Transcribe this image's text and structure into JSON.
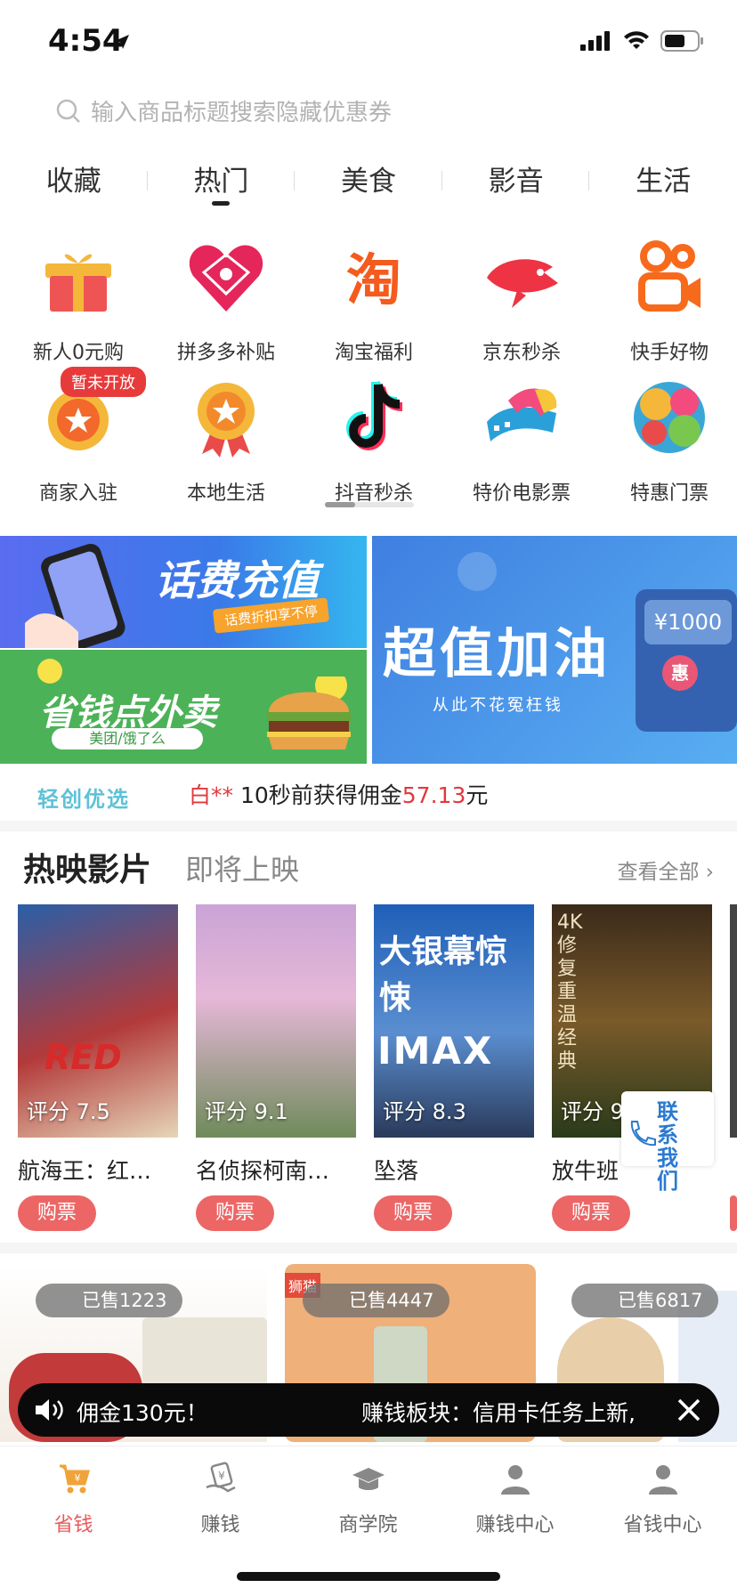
{
  "status": {
    "time": "4:54"
  },
  "search": {
    "placeholder": "输入商品标题搜索隐藏优惠券"
  },
  "tabs": [
    {
      "label": "收藏"
    },
    {
      "label": "热门"
    },
    {
      "label": "美食"
    },
    {
      "label": "影音"
    },
    {
      "label": "生活"
    }
  ],
  "grid": [
    {
      "label": "新人0元购",
      "icon": "gift-icon"
    },
    {
      "label": "拼多多补贴",
      "icon": "pinduoduo-icon"
    },
    {
      "label": "淘宝福利",
      "icon": "taobao-icon"
    },
    {
      "label": "京东秒杀",
      "icon": "jd-icon"
    },
    {
      "label": "快手好物",
      "icon": "kuaishou-icon"
    },
    {
      "label": "商家入驻",
      "icon": "merchant-icon"
    },
    {
      "label": "本地生活",
      "icon": "local-icon"
    },
    {
      "label": "抖音秒杀",
      "icon": "douyin-icon"
    },
    {
      "label": "特价电影票",
      "icon": "movie-ticket-icon"
    },
    {
      "label": "特惠门票",
      "icon": "ticket-icon"
    }
  ],
  "badge": "暂未开放",
  "banners": {
    "recharge": {
      "title": "话费充值",
      "sub": "话费折扣享不停"
    },
    "takeout": {
      "title": "省钱点外卖",
      "sub": "美团/饿了么"
    },
    "fuel": {
      "title": "超值加油",
      "sub": "从此不花冤枉钱",
      "price": "¥1000",
      "tag": "惠"
    }
  },
  "ticker": {
    "brand": "轻创优选",
    "user": "白**",
    "text": " 10秒前获得佣金",
    "amount": "57.13",
    "unit": "元"
  },
  "movies": {
    "hot_label": "热映影片",
    "upcoming_label": "即将上映",
    "see_all": "查看全部",
    "items": [
      {
        "title": "航海王：红…",
        "rating": "评分 7.5",
        "buy": "购票"
      },
      {
        "title": "名侦探柯南…",
        "rating": "评分 9.1",
        "buy": "购票"
      },
      {
        "title": "坠落",
        "rating": "评分 8.3",
        "buy": "购票"
      },
      {
        "title": "放牛班",
        "rating": "评分 9",
        "buy": "购票"
      }
    ],
    "contact": "联系我们"
  },
  "products": [
    {
      "sold": "已售1223"
    },
    {
      "sold": "已售4447"
    },
    {
      "sold": "已售6817"
    }
  ],
  "notice": {
    "left": "佣金130元！",
    "right": "赚钱板块：信用卡任务上新,"
  },
  "tabbar": [
    {
      "label": "省钱",
      "active": true
    },
    {
      "label": "赚钱"
    },
    {
      "label": "商学院"
    },
    {
      "label": "赚钱中心"
    },
    {
      "label": "省钱中心"
    }
  ],
  "colors": {
    "accent": "#e2383f",
    "brand": "#5ec1d8",
    "buy": "#ec6666",
    "tab_active": "#e85a5a"
  }
}
